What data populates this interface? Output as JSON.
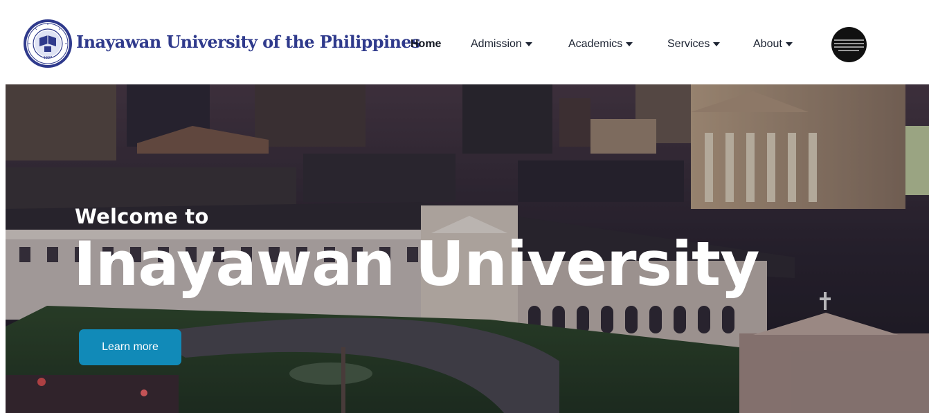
{
  "header": {
    "brand_name": "Inayawan University of the Philippines",
    "seal_ring_text": "UNIVERSITY OF THE PHILIPPINES",
    "seal_year": "1907",
    "nav": [
      {
        "label": "Home",
        "active": true,
        "has_dropdown": false
      },
      {
        "label": "Admission",
        "active": false,
        "has_dropdown": true
      },
      {
        "label": "Academics",
        "active": false,
        "has_dropdown": true
      },
      {
        "label": "Services",
        "active": false,
        "has_dropdown": true
      },
      {
        "label": "About",
        "active": false,
        "has_dropdown": true
      }
    ],
    "avatar_icon": "user-avatar"
  },
  "hero": {
    "welcome": "Welcome to",
    "title": "Inayawan University",
    "cta_label": "Learn more"
  },
  "colors": {
    "brand": "#2f3a8c",
    "cta": "#118ab8",
    "hero_text": "#ffffff"
  }
}
